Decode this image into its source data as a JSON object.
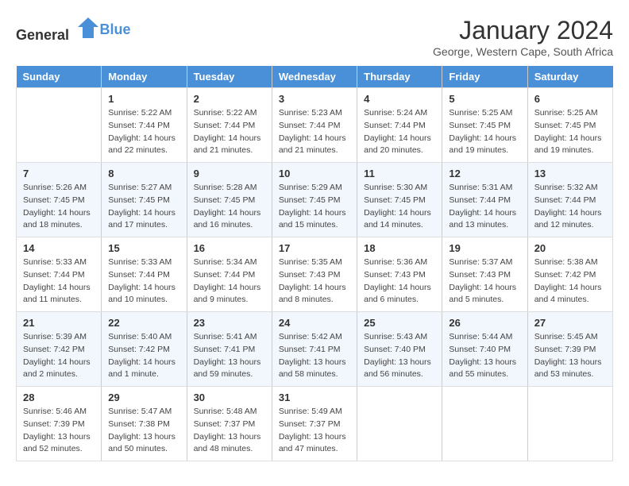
{
  "header": {
    "logo_general": "General",
    "logo_blue": "Blue",
    "title": "January 2024",
    "location": "George, Western Cape, South Africa"
  },
  "columns": [
    "Sunday",
    "Monday",
    "Tuesday",
    "Wednesday",
    "Thursday",
    "Friday",
    "Saturday"
  ],
  "weeks": [
    [
      {
        "day": "",
        "info": ""
      },
      {
        "day": "1",
        "info": "Sunrise: 5:22 AM\nSunset: 7:44 PM\nDaylight: 14 hours\nand 22 minutes."
      },
      {
        "day": "2",
        "info": "Sunrise: 5:22 AM\nSunset: 7:44 PM\nDaylight: 14 hours\nand 21 minutes."
      },
      {
        "day": "3",
        "info": "Sunrise: 5:23 AM\nSunset: 7:44 PM\nDaylight: 14 hours\nand 21 minutes."
      },
      {
        "day": "4",
        "info": "Sunrise: 5:24 AM\nSunset: 7:44 PM\nDaylight: 14 hours\nand 20 minutes."
      },
      {
        "day": "5",
        "info": "Sunrise: 5:25 AM\nSunset: 7:45 PM\nDaylight: 14 hours\nand 19 minutes."
      },
      {
        "day": "6",
        "info": "Sunrise: 5:25 AM\nSunset: 7:45 PM\nDaylight: 14 hours\nand 19 minutes."
      }
    ],
    [
      {
        "day": "7",
        "info": "Sunrise: 5:26 AM\nSunset: 7:45 PM\nDaylight: 14 hours\nand 18 minutes."
      },
      {
        "day": "8",
        "info": "Sunrise: 5:27 AM\nSunset: 7:45 PM\nDaylight: 14 hours\nand 17 minutes."
      },
      {
        "day": "9",
        "info": "Sunrise: 5:28 AM\nSunset: 7:45 PM\nDaylight: 14 hours\nand 16 minutes."
      },
      {
        "day": "10",
        "info": "Sunrise: 5:29 AM\nSunset: 7:45 PM\nDaylight: 14 hours\nand 15 minutes."
      },
      {
        "day": "11",
        "info": "Sunrise: 5:30 AM\nSunset: 7:45 PM\nDaylight: 14 hours\nand 14 minutes."
      },
      {
        "day": "12",
        "info": "Sunrise: 5:31 AM\nSunset: 7:44 PM\nDaylight: 14 hours\nand 13 minutes."
      },
      {
        "day": "13",
        "info": "Sunrise: 5:32 AM\nSunset: 7:44 PM\nDaylight: 14 hours\nand 12 minutes."
      }
    ],
    [
      {
        "day": "14",
        "info": "Sunrise: 5:33 AM\nSunset: 7:44 PM\nDaylight: 14 hours\nand 11 minutes."
      },
      {
        "day": "15",
        "info": "Sunrise: 5:33 AM\nSunset: 7:44 PM\nDaylight: 14 hours\nand 10 minutes."
      },
      {
        "day": "16",
        "info": "Sunrise: 5:34 AM\nSunset: 7:44 PM\nDaylight: 14 hours\nand 9 minutes."
      },
      {
        "day": "17",
        "info": "Sunrise: 5:35 AM\nSunset: 7:43 PM\nDaylight: 14 hours\nand 8 minutes."
      },
      {
        "day": "18",
        "info": "Sunrise: 5:36 AM\nSunset: 7:43 PM\nDaylight: 14 hours\nand 6 minutes."
      },
      {
        "day": "19",
        "info": "Sunrise: 5:37 AM\nSunset: 7:43 PM\nDaylight: 14 hours\nand 5 minutes."
      },
      {
        "day": "20",
        "info": "Sunrise: 5:38 AM\nSunset: 7:42 PM\nDaylight: 14 hours\nand 4 minutes."
      }
    ],
    [
      {
        "day": "21",
        "info": "Sunrise: 5:39 AM\nSunset: 7:42 PM\nDaylight: 14 hours\nand 2 minutes."
      },
      {
        "day": "22",
        "info": "Sunrise: 5:40 AM\nSunset: 7:42 PM\nDaylight: 14 hours\nand 1 minute."
      },
      {
        "day": "23",
        "info": "Sunrise: 5:41 AM\nSunset: 7:41 PM\nDaylight: 13 hours\nand 59 minutes."
      },
      {
        "day": "24",
        "info": "Sunrise: 5:42 AM\nSunset: 7:41 PM\nDaylight: 13 hours\nand 58 minutes."
      },
      {
        "day": "25",
        "info": "Sunrise: 5:43 AM\nSunset: 7:40 PM\nDaylight: 13 hours\nand 56 minutes."
      },
      {
        "day": "26",
        "info": "Sunrise: 5:44 AM\nSunset: 7:40 PM\nDaylight: 13 hours\nand 55 minutes."
      },
      {
        "day": "27",
        "info": "Sunrise: 5:45 AM\nSunset: 7:39 PM\nDaylight: 13 hours\nand 53 minutes."
      }
    ],
    [
      {
        "day": "28",
        "info": "Sunrise: 5:46 AM\nSunset: 7:39 PM\nDaylight: 13 hours\nand 52 minutes."
      },
      {
        "day": "29",
        "info": "Sunrise: 5:47 AM\nSunset: 7:38 PM\nDaylight: 13 hours\nand 50 minutes."
      },
      {
        "day": "30",
        "info": "Sunrise: 5:48 AM\nSunset: 7:37 PM\nDaylight: 13 hours\nand 48 minutes."
      },
      {
        "day": "31",
        "info": "Sunrise: 5:49 AM\nSunset: 7:37 PM\nDaylight: 13 hours\nand 47 minutes."
      },
      {
        "day": "",
        "info": ""
      },
      {
        "day": "",
        "info": ""
      },
      {
        "day": "",
        "info": ""
      }
    ]
  ]
}
